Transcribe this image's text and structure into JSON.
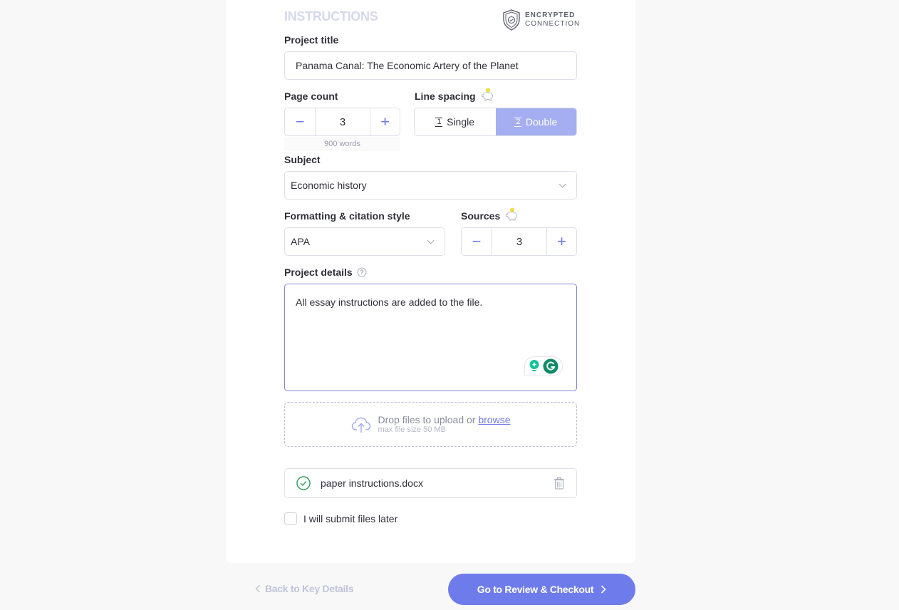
{
  "section": {
    "title": "INSTRUCTIONS",
    "secure_line1": "ENCRYPTED",
    "secure_line2": "CONNECTION"
  },
  "project_title": {
    "label": "Project title",
    "value": "Panama Canal: The Economic Artery of the Planet"
  },
  "page_count": {
    "label": "Page count",
    "value": "3",
    "minus": "−",
    "plus": "+",
    "words": "900 words"
  },
  "line_spacing": {
    "label": "Line spacing",
    "options": [
      {
        "icon": "1",
        "label": "Single",
        "selected": false
      },
      {
        "icon": "2",
        "label": "Double",
        "selected": true
      }
    ]
  },
  "subject": {
    "label": "Subject",
    "value": "Economic history"
  },
  "citation": {
    "label": "Formatting & citation style",
    "value": "APA"
  },
  "sources": {
    "label": "Sources",
    "value": "3",
    "minus": "−",
    "plus": "+"
  },
  "details": {
    "label": "Project details",
    "value": "All essay instructions are added to the file."
  },
  "upload": {
    "text": "Drop files to upload or ",
    "browse": "browse",
    "limit": "max file size 50 MB"
  },
  "files": [
    {
      "name": "paper instructions.docx",
      "status": "uploaded"
    }
  ],
  "submit_later": {
    "label": "I will submit files later",
    "checked": false
  },
  "nav": {
    "back": "Back to Key Details",
    "next": "Go to Review & Checkout"
  },
  "colors": {
    "accent": "#6e7bea",
    "selected_option": "#a5aef0",
    "success": "#2e9e5b"
  }
}
